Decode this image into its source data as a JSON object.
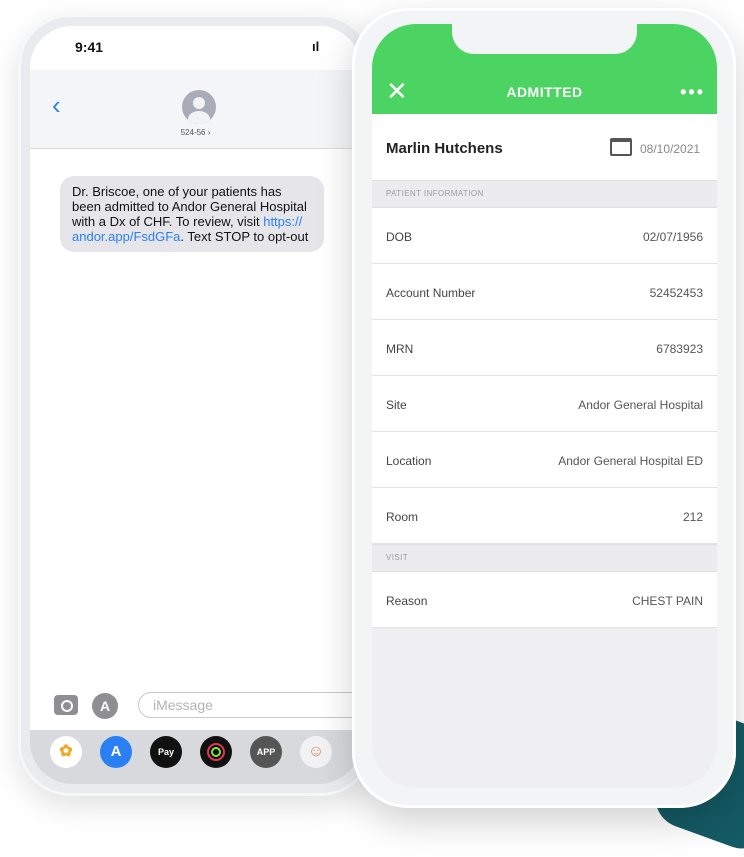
{
  "messages_phone": {
    "status_time": "9:41",
    "status_icons": "▐▌☰",
    "contact_number": "524-56 ›",
    "message_text_parts": {
      "before_link": "Dr. Briscoe, one of your patients has been admitted to Andor General Hospital with a Dx of CHF. To review, visit ",
      "link": "https:// andor.app/FsdGFa",
      "after_link": ". Text STOP to opt-out"
    },
    "compose_placeholder": "iMessage",
    "dock_apps": [
      {
        "name": "photos-icon",
        "label": "",
        "color": "#f5a623"
      },
      {
        "name": "app-store-icon",
        "label": "A",
        "color": "#2b7ff5"
      },
      {
        "name": "apple-pay-icon",
        "label": "Pay",
        "color": "#111111"
      },
      {
        "name": "activity-icon",
        "label": "",
        "color": "#111111"
      },
      {
        "name": "app-icon",
        "label": "APP",
        "color": "#555555"
      },
      {
        "name": "memoji-icon",
        "label": "",
        "color": "#c98a5a"
      }
    ]
  },
  "app_phone": {
    "header_title": "ADMITTED",
    "header_color": "#4cd462",
    "patient_name": "Marlin Hutchens",
    "patient_date": "08/10/2021",
    "patient_info_heading": "PATIENT INFORMATION",
    "patient_info": [
      {
        "label": "DOB",
        "value": "02/07/1956"
      },
      {
        "label": "Account Number",
        "value": "52452453"
      },
      {
        "label": "MRN",
        "value": "6783923"
      },
      {
        "label": "Site",
        "value": "Andor General Hospital"
      },
      {
        "label": "Location",
        "value": "Andor General Hospital ED"
      },
      {
        "label": "Room",
        "value": "212"
      }
    ],
    "visit_heading": "VISIT",
    "visit": [
      {
        "label": "Reason",
        "value": "CHEST PAIN"
      }
    ]
  }
}
